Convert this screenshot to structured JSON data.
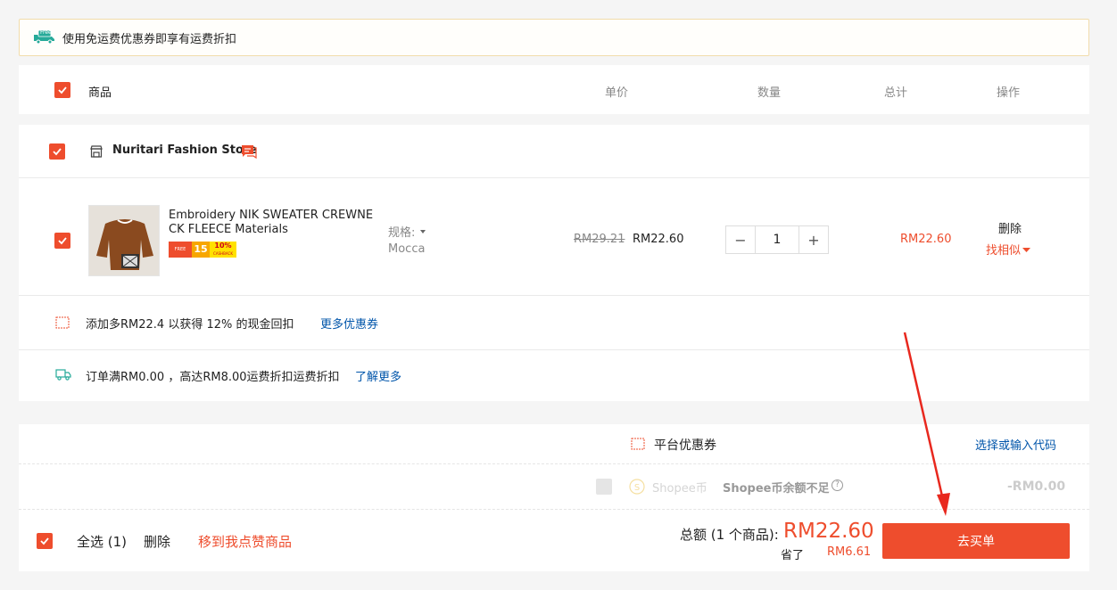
{
  "banner": {
    "free_badge": "Free",
    "text": "使用免运费优惠券即享有运费折扣"
  },
  "header": {
    "product": "商品",
    "unit_price": "单价",
    "quantity": "数量",
    "total": "总计",
    "actions": "操作"
  },
  "shop": {
    "name": "Nuritari Fashion Store"
  },
  "item": {
    "title": "Embroidery NIK SWEATER CREWNECK FLEECE Materials",
    "promo_free": "FREE",
    "promo_num": "15",
    "promo_pct": "10%",
    "promo_cash": "CASHBACK",
    "variation_label": "规格:",
    "variation_value": "Mocca",
    "price_original": "RM29.21",
    "price_current": "RM22.60",
    "quantity": "1",
    "qty_minus": "−",
    "qty_plus": "+",
    "subtotal": "RM22.60",
    "delete_label": "删除",
    "similar_label": "找相似"
  },
  "cashback": {
    "text": "添加多RM22.4 以获得 12% 的现金回扣",
    "link": "更多优惠券"
  },
  "shipping": {
    "text": "订单满RM0.00 ，高达RM8.00运费折扣运费折扣",
    "link": "了解更多"
  },
  "voucher": {
    "label": "平台优惠券",
    "action": "选择或输入代码"
  },
  "coins": {
    "label": "Shopee币",
    "status": "Shopee币余额不足",
    "help": "?",
    "amount": "-RM0.00"
  },
  "footer": {
    "select_all": "全选 (1)",
    "delete": "删除",
    "move_to_likes": "移到我点赞商品",
    "total_label": "总额 (1 个商品):",
    "total_value": "RM22.60",
    "saved_label": "省了",
    "saved_value": "RM6.61",
    "checkout": "去买单"
  },
  "colors": {
    "accent": "#ee4d2d",
    "link": "#0055aa",
    "teal": "#26aa99"
  }
}
